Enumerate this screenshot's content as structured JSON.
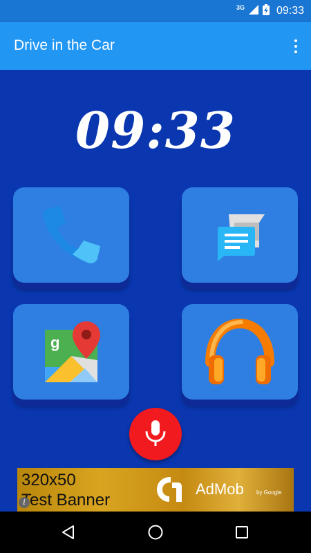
{
  "status_bar": {
    "network_type": "3G",
    "time": "09:33",
    "icons": [
      "signal-icon",
      "battery-charging-icon"
    ]
  },
  "app_bar": {
    "title": "Drive in the Car",
    "menu_icon": "overflow-menu-icon"
  },
  "main": {
    "clock": "09:33",
    "tiles": [
      {
        "name": "phone",
        "icon": "phone-icon"
      },
      {
        "name": "messages",
        "icon": "messages-icon"
      },
      {
        "name": "maps",
        "icon": "google-maps-icon"
      },
      {
        "name": "music",
        "icon": "headphones-icon"
      }
    ],
    "mic_icon": "microphone-icon"
  },
  "ad": {
    "size": "320x50",
    "label": "Test Banner",
    "brand": "AdMob",
    "by": "by Google",
    "info_icon": "i"
  },
  "nav_bar": {
    "icons": [
      "back-icon",
      "home-icon",
      "recents-icon"
    ]
  },
  "colors": {
    "status_bar": "#1976d2",
    "app_bar": "#2196f3",
    "background": "#0a37b0",
    "tile": "#2f7fe3",
    "mic": "#f01a1f"
  }
}
